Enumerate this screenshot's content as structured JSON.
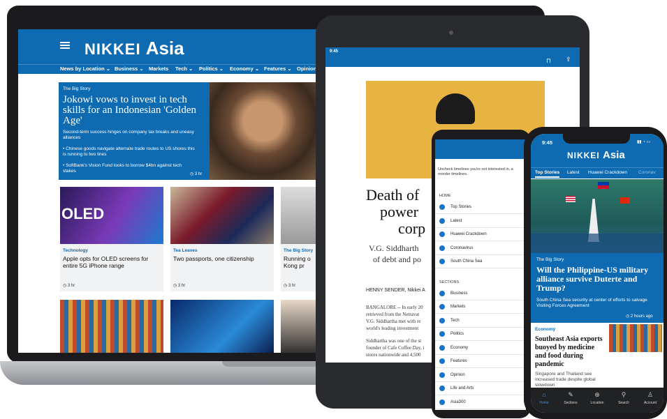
{
  "laptop": {
    "brand_a": "NIKKEI",
    "brand_b": "Asia",
    "nav": [
      "News by Location ⌄",
      "Business ⌄",
      "Markets",
      "Tech ⌄",
      "Politics ⌄",
      "Economy ⌄",
      "Features ⌄",
      "Opinion"
    ],
    "hero": {
      "tag": "The Big Story",
      "title": "Jokowi vows to invest in tech skills for an Indonesian 'Golden Age'",
      "subtitle": "Second-term success hinges on company tax breaks and uneasy alliances",
      "bullets": [
        "• Chinese goods navigate alternate trade routes to US shores this is running to two lines",
        "• SoftBank's Vision Fund looks to borrow $4bn against tech stakes"
      ],
      "time": "3 hr"
    },
    "cards": [
      {
        "tag": "Technology",
        "title": "Apple opts for OLED screens for entire 5G iPhone range",
        "time": "3 hr",
        "img_text": "OLED"
      },
      {
        "tag": "Tea Leaves",
        "title": "Two passports, one citizenship",
        "time": "3 hr"
      },
      {
        "tag": "The Big Story",
        "title": "Running o Kong pr",
        "time": "3 hr"
      }
    ]
  },
  "tablet": {
    "time": "9:45",
    "headline": [
      "Death of",
      "power",
      "corp"
    ],
    "subhead": [
      "V.G. Siddharth",
      "of debt and po"
    ],
    "byline": "HENNY SENDER, Nikkei A",
    "body": [
      "BANGALORE -- In early 20",
      "retrieved from the Netravat",
      "V.G. Siddhartha met with re",
      "world's leading investment"
    ],
    "body2": [
      "Siddhartha was one of the st",
      "founder of Cafe Coffee Day, i",
      "stores nationwide and 4,500"
    ]
  },
  "android": {
    "intro": "Uncheck timelines you're not interested in, a reorder timelines.",
    "home_label": "HOME",
    "home_items": [
      "Top Stories",
      "Latest",
      "Huawei Crackdown",
      "Coronavirus",
      "South China Sea"
    ],
    "sections_label": "SECTIONS",
    "section_items": [
      "Business",
      "Markets",
      "Tech",
      "Politics",
      "Economy",
      "Features",
      "Opinion",
      "Life and Arts",
      "Asia300"
    ]
  },
  "iphone": {
    "time": "9:45",
    "brand_a": "NIKKEI",
    "brand_b": "Asia",
    "tabs": [
      "Top Stories",
      "Latest",
      "Huawei Crackdown",
      "Coronav"
    ],
    "story": {
      "tag": "The Big Story",
      "title": "Will the Philippine-US military alliance survive Duterte and Trump?",
      "sub": "South China Sea security at center of efforts to salvage Visiting Forces Agreement",
      "time": "2 hours ago"
    },
    "story2": {
      "tag": "Economy",
      "title": "Southeast Asia exports buoyed by medicine and food during pandemic",
      "sub": "Singapore and Thailand see increased trade despite global slowdown"
    },
    "footer": [
      "Home",
      "Sections",
      "Location",
      "Search",
      "Account"
    ]
  }
}
